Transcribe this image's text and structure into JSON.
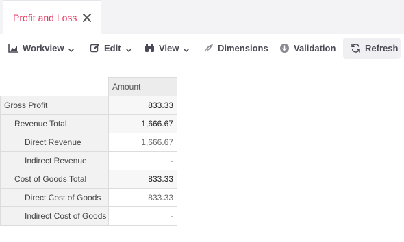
{
  "tab": {
    "title": "Profit and Loss",
    "close_icon": "close-icon"
  },
  "toolbar": {
    "workview": {
      "label": "Workview",
      "icon": "chart-icon"
    },
    "edit": {
      "label": "Edit",
      "icon": "pencil-icon"
    },
    "view": {
      "label": "View",
      "icon": "binoculars-icon"
    },
    "dimensions": {
      "label": "Dimensions",
      "icon": "dimensions-icon"
    },
    "validation": {
      "label": "Validation",
      "icon": "download-circle-icon"
    },
    "refresh": {
      "label": "Refresh",
      "icon": "refresh-icon"
    }
  },
  "table": {
    "column_header": "Amount",
    "rows": [
      {
        "label": "Gross Profit",
        "value": "833.33"
      },
      {
        "label": "Revenue Total",
        "value": "1,666.67"
      },
      {
        "label": "Direct Revenue",
        "value": "1,666.67"
      },
      {
        "label": "Indirect Revenue",
        "value": "-"
      },
      {
        "label": "Cost of Goods Total",
        "value": "833.33"
      },
      {
        "label": "Direct Cost of Goods",
        "value": "833.33"
      },
      {
        "label": "Indirect Cost of Goods",
        "value": "-"
      }
    ]
  },
  "colors": {
    "tab_accent": "#e5375e",
    "toolbar_text": "#4a4a55"
  }
}
